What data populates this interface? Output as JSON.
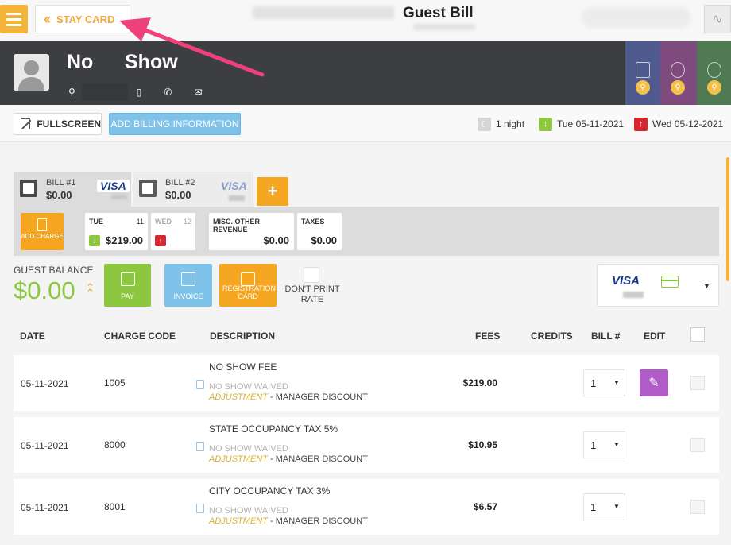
{
  "topbar": {
    "menu_icon": "hamburger-icon",
    "back_label": "STAY CARD",
    "back_icon": "double-chevron-left-icon",
    "title": "Guest Bill",
    "activity_icon": "activity-icon"
  },
  "guest": {
    "first_name": "No",
    "last_name": "Show",
    "icons": [
      "location-icon",
      "mobile-icon",
      "phone-icon",
      "email-icon"
    ]
  },
  "toolbar": {
    "fullscreen_label": "FULLSCREEN",
    "billing_label": "ADD BILLING INFORMATION",
    "nights": "1 night",
    "arrival": "Tue 05-11-2021",
    "departure": "Wed 05-12-2021"
  },
  "bills": [
    {
      "name": "BILL #1",
      "amount": "$0.00",
      "card": "VISA"
    },
    {
      "name": "BILL #2",
      "amount": "$0.00",
      "card": "VISA"
    }
  ],
  "add_bill_label": "+",
  "charges": {
    "add_charge_label": "ADD CHARGE",
    "days": [
      {
        "day": "TUE",
        "num": "11",
        "amount": "$219.00"
      },
      {
        "day": "WED",
        "num": "12",
        "amount": ""
      }
    ],
    "misc_label": "MISC. OTHER REVENUE",
    "misc_amount": "$0.00",
    "taxes_label": "TAXES",
    "taxes_amount": "$0.00"
  },
  "balance": {
    "label": "GUEST BALANCE",
    "value": "$0.00"
  },
  "actions": {
    "pay": "PAY",
    "invoice": "INVOICE",
    "registration": "REGISTRATION CARD",
    "dont_print": "DON'T PRINT RATE"
  },
  "payment_card": {
    "brand": "VISA"
  },
  "table": {
    "headers": [
      "DATE",
      "CHARGE CODE",
      "DESCRIPTION",
      "FEES",
      "CREDITS",
      "BILL #",
      "EDIT"
    ],
    "rows": [
      {
        "date": "05-11-2021",
        "code": "1005",
        "description": "NO SHOW FEE",
        "waived": "NO SHOW WAIVED",
        "adjustment": "ADJUSTMENT",
        "adjustment_note": "- MANAGER DISCOUNT",
        "fees": "$219.00",
        "bill": "1"
      },
      {
        "date": "05-11-2021",
        "code": "8000",
        "description": "STATE OCCUPANCY TAX 5%",
        "waived": "NO SHOW WAIVED",
        "adjustment": "ADJUSTMENT",
        "adjustment_note": "- MANAGER DISCOUNT",
        "fees": "$10.95",
        "bill": "1"
      },
      {
        "date": "05-11-2021",
        "code": "8001",
        "description": "CITY OCCUPANCY TAX 3%",
        "waived": "NO SHOW WAIVED",
        "adjustment": "ADJUSTMENT",
        "adjustment_note": "- MANAGER DISCOUNT",
        "fees": "$6.57",
        "bill": "1"
      }
    ]
  },
  "colors": {
    "accent": "#f4a621",
    "header_bg": "#3d3e42",
    "balance_green": "#8dc63f",
    "edit_purple": "#b05cc8",
    "billing_blue": "#7fc3ea",
    "annotation_pink": "#f0407a"
  }
}
